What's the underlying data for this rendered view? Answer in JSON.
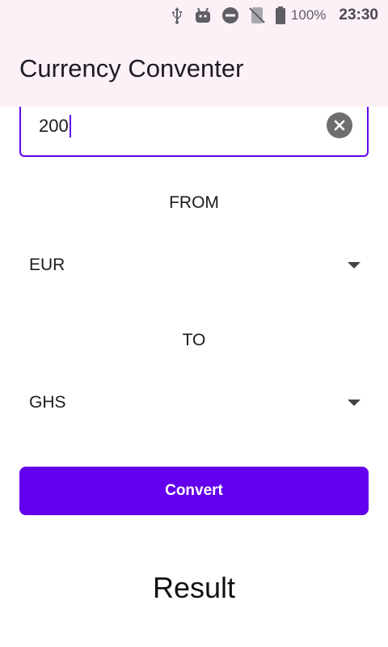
{
  "status_bar": {
    "icons": [
      "usb-icon",
      "android-debug-icon",
      "do-not-disturb-icon",
      "no-sim-icon",
      "battery-icon"
    ],
    "battery_percent": "100%",
    "time": "23:30"
  },
  "app_bar": {
    "title": "Currency Conventer"
  },
  "amount_field": {
    "value": "200",
    "clear_icon": "clear-circle-icon"
  },
  "from_section": {
    "label": "FROM",
    "selected": "EUR"
  },
  "to_section": {
    "label": "TO",
    "selected": "GHS"
  },
  "convert_button": {
    "label": "Convert"
  },
  "result": {
    "text": "Result"
  },
  "colors": {
    "accent": "#6200ee",
    "app_bar_bg": "#fdf1f8"
  }
}
